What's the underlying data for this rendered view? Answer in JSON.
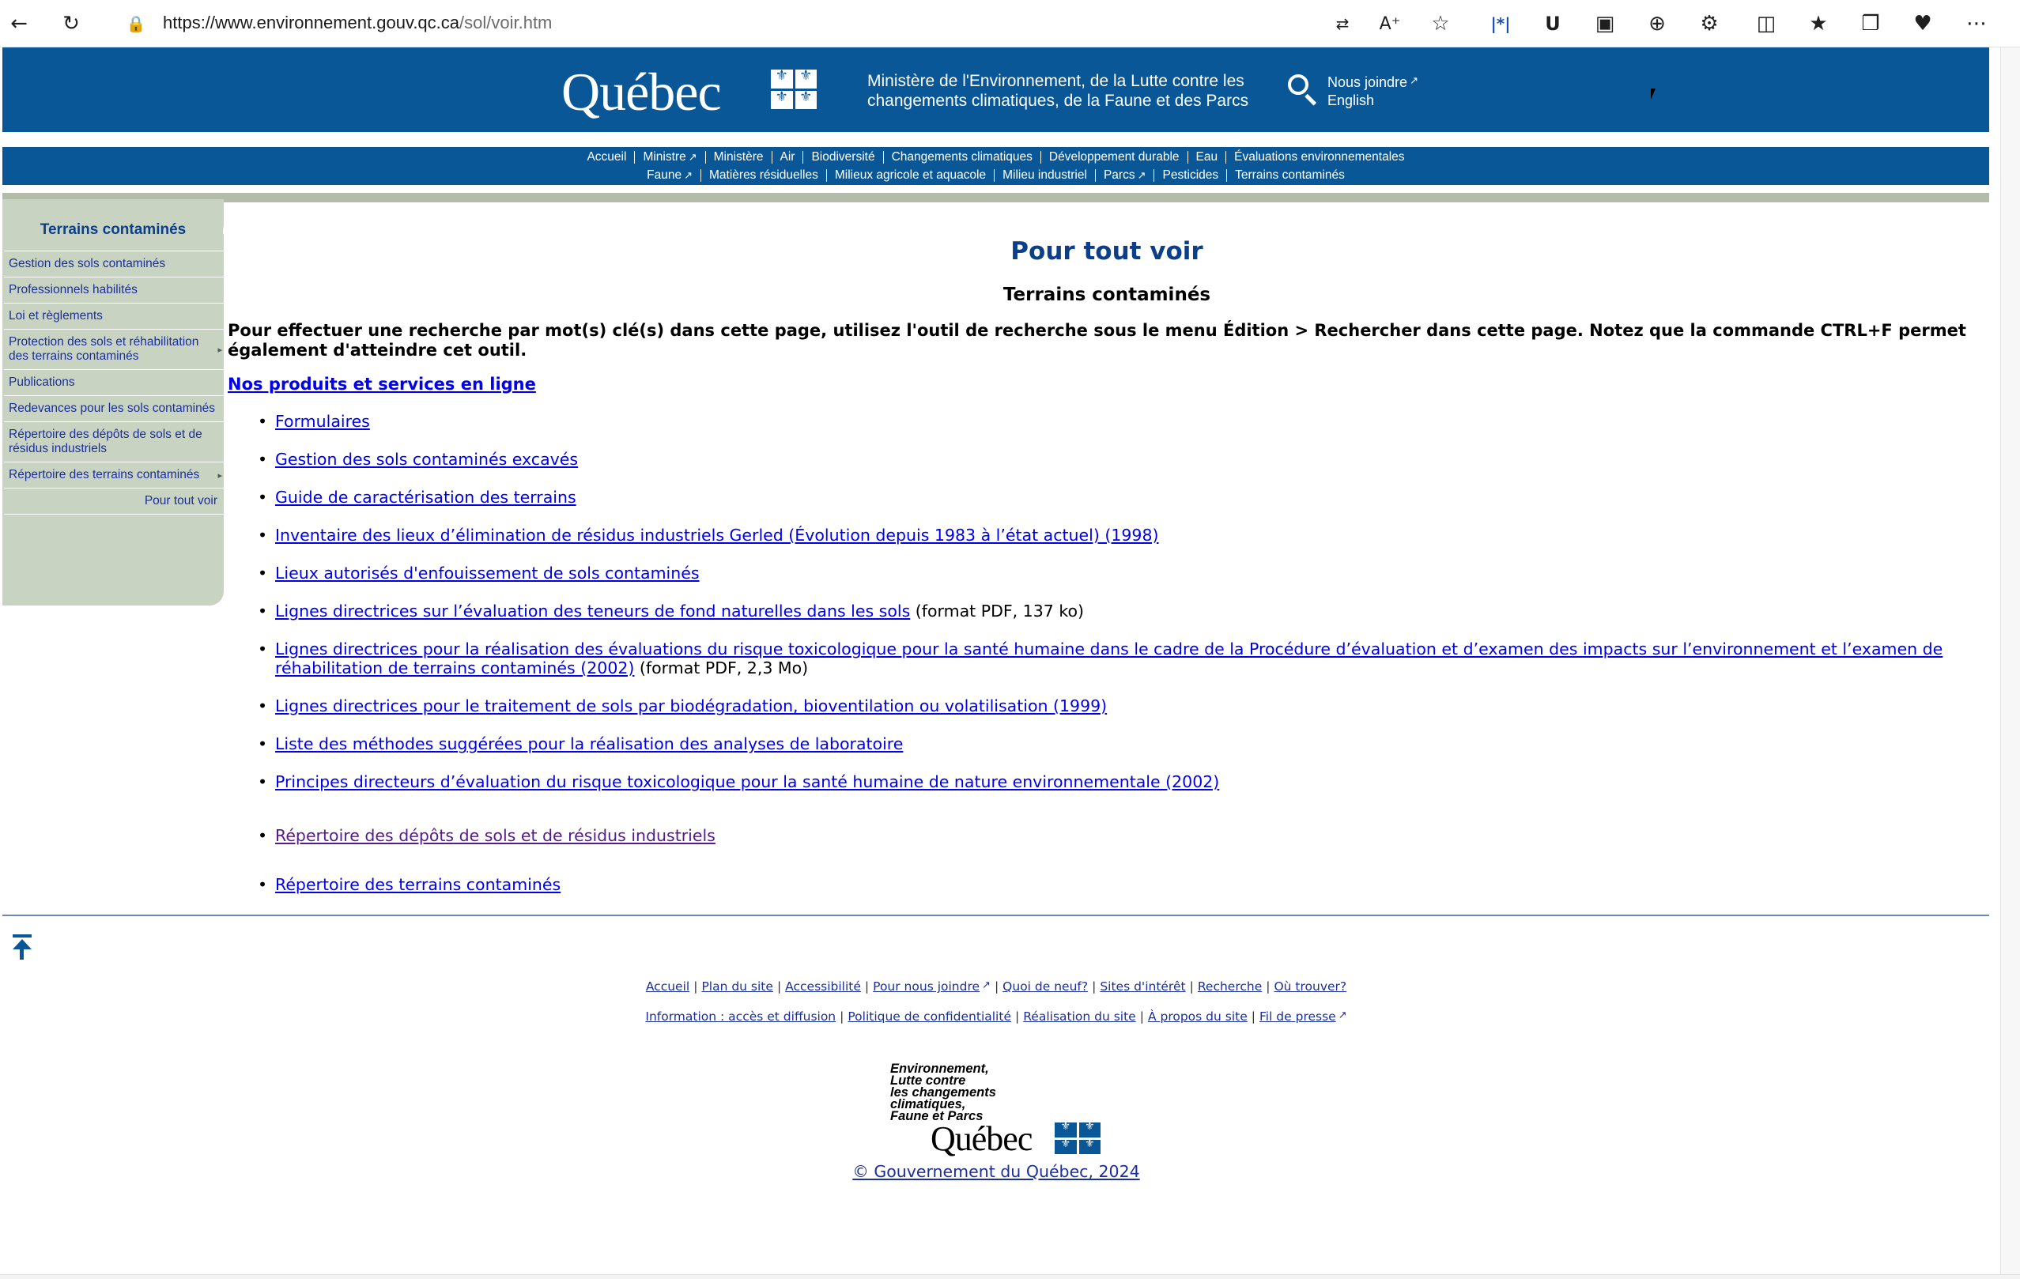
{
  "browser": {
    "url_host": "https://www.environnement.gouv.qc.ca",
    "url_path": "/sol/voir.htm"
  },
  "header": {
    "logo_text": "Québec",
    "ministry": "Ministère de l'Environnement, de la Lutte contre les changements climatiques, de la Faune et des Parcs",
    "contact": "Nous joindre",
    "english": "English"
  },
  "nav": {
    "row1": [
      "Accueil",
      "Ministre",
      "Ministère",
      "Air",
      "Biodiversité",
      "Changements climatiques",
      "Développement durable",
      "Eau",
      "Évaluations environnementales"
    ],
    "row2": [
      "Faune",
      "Matières résiduelles",
      "Milieux agricole et aquacole",
      "Milieu industriel",
      "Parcs",
      "Pesticides",
      "Terrains contaminés"
    ]
  },
  "sidebar": {
    "title": "Terrains contaminés",
    "items": [
      "Gestion des sols contaminés",
      "Professionnels habilités",
      "Loi et règlements",
      "Protection des sols et réhabilitation des terrains contaminés",
      "Publications",
      "Redevances pour les sols contaminés",
      "Répertoire des dépôts de sols et de résidus industriels",
      "Répertoire des terrains contaminés",
      "Pour tout voir"
    ]
  },
  "main": {
    "title": "Pour tout voir",
    "subtitle": "Terrains contaminés",
    "search_tip": "Pour effectuer une recherche par mot(s) clé(s) dans cette page, utilisez l'outil de recherche sous le menu Édition > Rechercher dans cette page. Notez que la commande CTRL+F permet également d'atteindre cet outil.",
    "section_heading": "Nos produits et services en ligne",
    "items": [
      {
        "link": "Formulaires",
        "note": ""
      },
      {
        "link": "Gestion des sols contaminés excavés",
        "note": ""
      },
      {
        "link": "Guide de caractérisation des terrains",
        "note": ""
      },
      {
        "link": "Inventaire des lieux d’élimination de résidus industriels Gerled (Évolution depuis 1983 à l’état actuel) (1998)",
        "note": ""
      },
      {
        "link": "Lieux autorisés d'enfouissement de sols contaminés",
        "note": ""
      },
      {
        "link": "Lignes directrices sur l’évaluation des teneurs de fond naturelles dans les sols",
        "note": " (format PDF, 137 ko)"
      },
      {
        "link": "Lignes directrices pour la réalisation des évaluations du risque toxicologique pour la santé humaine dans le cadre de la Procédure d’évaluation et d’examen des impacts sur l’environnement et l’examen de réhabilitation de terrains contaminés (2002)",
        "note": " (format PDF, 2,3 Mo)"
      },
      {
        "link": "Lignes directrices pour le traitement de sols par biodégradation, bioventilation ou volatilisation (1999)",
        "note": ""
      },
      {
        "link": "Liste des méthodes suggérées pour la réalisation des analyses de laboratoire",
        "note": ""
      },
      {
        "link": "Principes directeurs d’évaluation du risque toxicologique pour la santé humaine de nature environnementale (2002)",
        "note": ""
      },
      {
        "link": "Répertoire des dépôts de sols et de résidus industriels",
        "note": ""
      },
      {
        "link": "Répertoire des terrains contaminés",
        "note": ""
      }
    ]
  },
  "footer": {
    "links1": [
      "Accueil",
      "Plan du site",
      "Accessibilité",
      "Pour nous joindre",
      "Quoi de neuf?",
      "Sites d'intérêt",
      "Recherche",
      "Où trouver?"
    ],
    "links2": [
      "Information : accès et diffusion",
      "Politique de confidentialité",
      "Réalisation du site",
      "À propos du site",
      "Fil de presse"
    ],
    "logo_lines": [
      "Environnement,",
      "Lutte contre",
      "les changements",
      "climatiques,",
      "Faune et Parcs"
    ],
    "logo_word": "Québec",
    "copyright": "© Gouvernement du Québec, 2024"
  }
}
